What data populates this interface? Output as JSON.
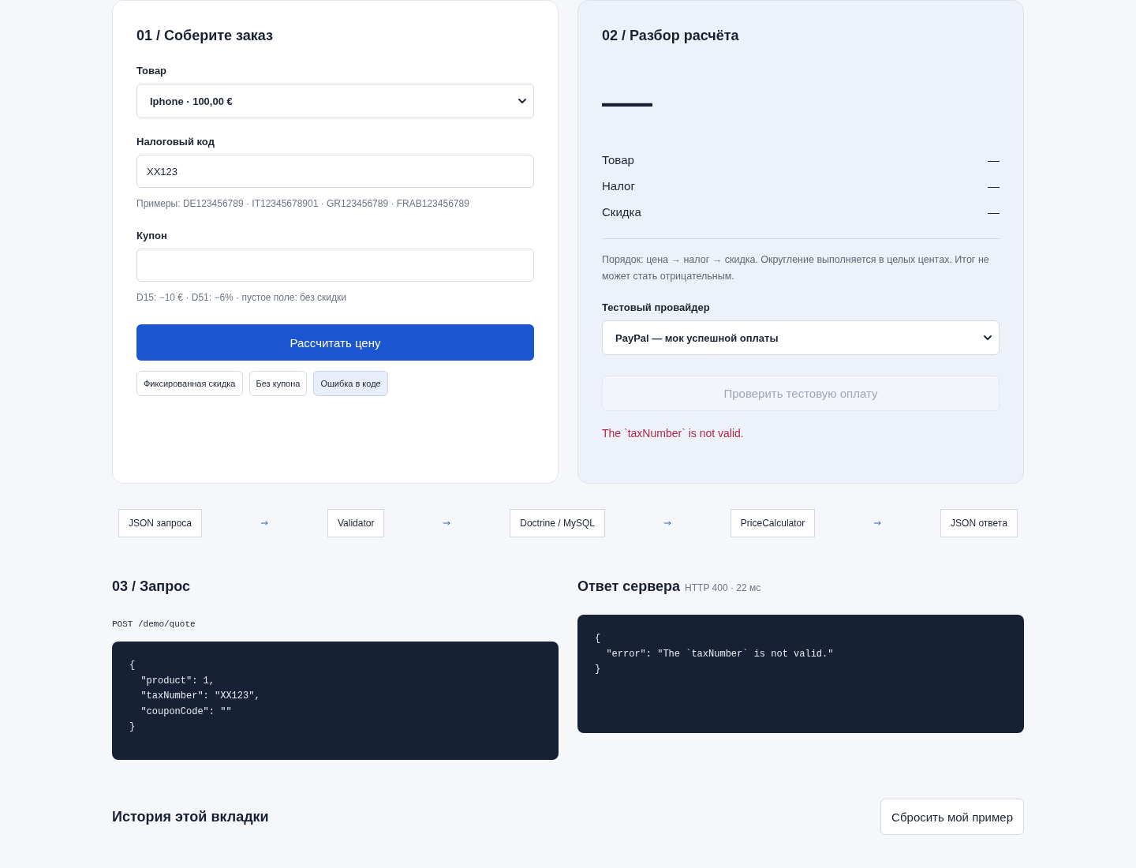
{
  "order_card": {
    "title": "01 / Соберите заказ",
    "product": {
      "label": "Товар",
      "value": "Iphone · 100,00 €"
    },
    "tax_number": {
      "label": "Налоговый код",
      "value": "XX123",
      "hint": "Примеры: DE123456789 · IT12345678901 · GR123456789 · FRAB123456789"
    },
    "coupon": {
      "label": "Купон",
      "hint": "D15: −10 € · D51: −6% · пустое поле: без скидки"
    },
    "submit_button": "Рассчитать цену",
    "presets": [
      {
        "label": "Фиксированная скидка",
        "selected": false
      },
      {
        "label": "Без купона",
        "selected": false
      },
      {
        "label": "Ошибка в коде",
        "selected": true
      }
    ]
  },
  "breakdown_card": {
    "title": "02 / Разбор расчёта",
    "total": "—",
    "rows": [
      {
        "label": "Товар",
        "value": "—"
      },
      {
        "label": "Налог",
        "value": "—"
      },
      {
        "label": "Скидка",
        "value": "—"
      }
    ],
    "note": "Порядок: цена → налог → скидка. Округление выполняется в целых центах. Итог не может стать отрицательным.",
    "provider": {
      "label": "Тестовый провайдер",
      "value": "PayPal — мок успешной оплаты"
    },
    "pay_button": {
      "label": "Проверить тестовую оплату",
      "disabled": true
    },
    "error": "The `taxNumber` is not valid."
  },
  "pipeline": [
    "JSON запроса",
    "Validator",
    "Doctrine / MySQL",
    "PriceCalculator",
    "JSON ответа"
  ],
  "request": {
    "title": "03 / Запрос",
    "endpoint": "POST /demo/quote",
    "body": "{\n  \"product\": 1,\n  \"taxNumber\": \"XX123\",\n  \"couponCode\": \"\"\n}"
  },
  "response": {
    "title": "Ответ сервера",
    "status": "HTTP 400 · 22 мс",
    "body": "{\n  \"error\": \"The `taxNumber` is not valid.\"\n}"
  },
  "history": {
    "title": "История этой вкладки",
    "reset_button": "Сбросить мой пример"
  }
}
